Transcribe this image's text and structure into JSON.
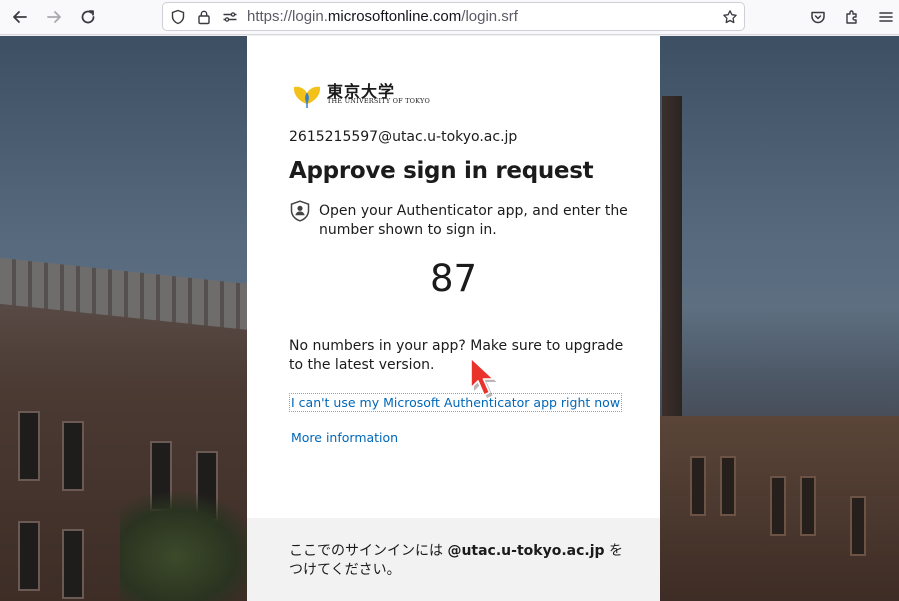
{
  "browser": {
    "url_prefix": "https://login.",
    "url_host": "microsoftonline.com",
    "url_path": "/login.srf",
    "icons": [
      "back-icon",
      "forward-icon",
      "reload-icon",
      "shield-icon",
      "lock-icon",
      "permissions-icon",
      "bookmark-star-icon",
      "pocket-icon",
      "extensions-icon",
      "menu-icon"
    ]
  },
  "logo": {
    "jp": "東京大学",
    "en": "THE UNIVERSITY OF TOKYO"
  },
  "signin": {
    "identity": "2615215597@utac.u-tokyo.ac.jp",
    "title": "Approve sign in request",
    "instruction": "Open your Authenticator app, and enter the number shown to sign in.",
    "number": "87",
    "upgrade_text": "No numbers in your app? Make sure to upgrade to the latest version.",
    "cant_use_link": "I can't use my Microsoft Authenticator app right now",
    "more_info_link": "More information"
  },
  "footer": {
    "prefix": "ここでのサインインには ",
    "domain": "@utac.u-tokyo.ac.jp",
    "suffix": " を つけてください。"
  },
  "colors": {
    "link": "#0067b8",
    "text": "#1b1b1b",
    "cursor": "#e8322b"
  }
}
